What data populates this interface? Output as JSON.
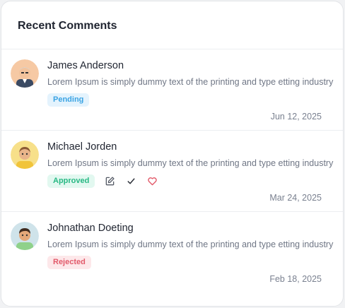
{
  "card": {
    "title": "Recent Comments"
  },
  "comments": [
    {
      "name": "James Anderson",
      "text": "Lorem Ipsum is simply dummy text of the printing and type etting industry",
      "status": "Pending",
      "date": "Jun 12, 2025"
    },
    {
      "name": "Michael Jorden",
      "text": "Lorem Ipsum is simply dummy text of the printing and type etting industry",
      "status": "Approved",
      "date": "Mar 24, 2025",
      "actions": [
        "edit-icon",
        "check-icon",
        "heart-icon"
      ]
    },
    {
      "name": "Johnathan Doeting",
      "text": "Lorem Ipsum is simply dummy text of the printing and type etting industry",
      "status": "Rejected",
      "date": "Feb 18, 2025"
    }
  ],
  "colors": {
    "pending": "#3aa3e3",
    "approved": "#27b883",
    "rejected": "#e25a6a",
    "heart": "#e25a6a"
  }
}
